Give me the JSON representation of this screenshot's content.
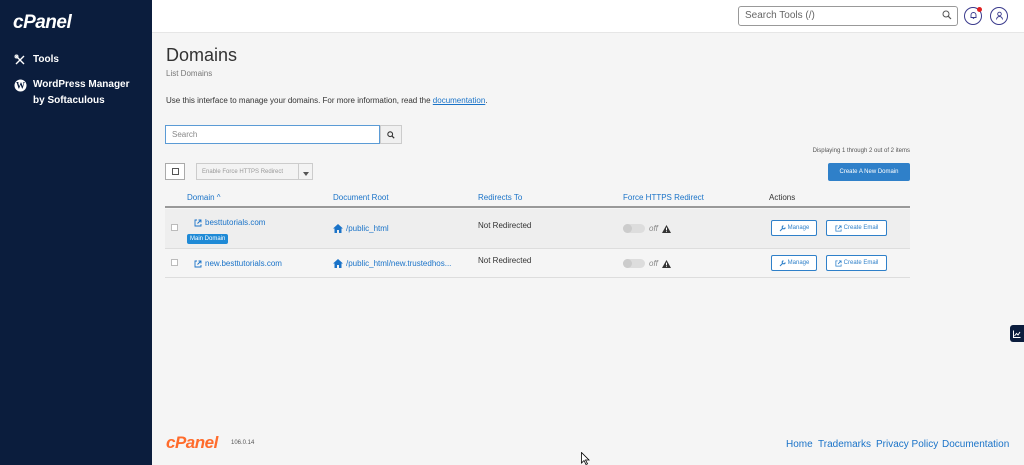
{
  "sidebar": {
    "logo": "cPanel",
    "items": [
      {
        "label": "Tools",
        "icon": "tools-icon"
      },
      {
        "label": "WordPress Manager by Softaculous",
        "icon": "wordpress-icon"
      }
    ]
  },
  "header": {
    "search_placeholder": "Search Tools (/)"
  },
  "page": {
    "title": "Domains",
    "subtitle": "List Domains",
    "intro_text": "Use this interface to manage your domains. For more information, read the ",
    "intro_link": "documentation",
    "intro_end": "."
  },
  "toolbar": {
    "search_placeholder": "Search",
    "display_count": "Displaying 1 through 2 out of 2 items",
    "https_redirect_label": "Enable Force HTTPS Redirect",
    "create_domain_label": "Create A New Domain"
  },
  "table": {
    "columns": [
      "Domain ^",
      "Document Root",
      "Redirects To",
      "Force HTTPS Redirect",
      "Actions"
    ],
    "rows": [
      {
        "domain": "besttutorials.com",
        "badge": "Main Domain",
        "docroot": "/public_html",
        "redirects": "Not Redirected",
        "https": "off",
        "manage": "Manage",
        "email": "Create Email"
      },
      {
        "domain": "new.besttutorials.com",
        "badge": "",
        "docroot": "/public_html/new.trustedhos...",
        "redirects": "Not Redirected",
        "https": "off",
        "manage": "Manage",
        "email": "Create Email"
      }
    ]
  },
  "footer": {
    "logo": "cPanel",
    "version": "106.0.14",
    "links": [
      "Home",
      "Trademarks",
      "Privacy Policy",
      "Documentation"
    ]
  },
  "colors": {
    "sidebar_bg": "#0b1d3d",
    "accent": "#2f80c9",
    "footer_logo": "#ff6c2c"
  }
}
